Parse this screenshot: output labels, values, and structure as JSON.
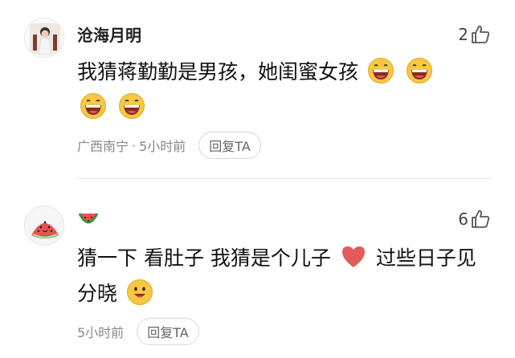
{
  "comments": [
    {
      "username": "沧海月明",
      "like_count": "2",
      "content_text": "我猜蒋勤勤是男孩，她闺蜜女孩",
      "content_emojis": [
        "grinning-emoji",
        "grinning-emoji",
        "grinning-emoji",
        "grinning-emoji"
      ],
      "meta_location": "广西南宁",
      "meta_separator": "·",
      "meta_time": "5小时前",
      "reply_label": "回复TA"
    },
    {
      "username": "",
      "name_badge": "watermelon-icon",
      "like_count": "6",
      "content_part1": "猜一下 看肚子 我猜是个儿子",
      "content_heart": "heart-icon",
      "content_part2": "过些日子见分晓",
      "content_emoji_end": "smile-emoji",
      "meta_time": "5小时前",
      "reply_label": "回复TA"
    }
  ],
  "colors": {
    "emoji_yellow": "#F7C843",
    "heart_red": "#E35A5A",
    "meta_gray": "#888888",
    "divider": "#E5E5E5"
  }
}
